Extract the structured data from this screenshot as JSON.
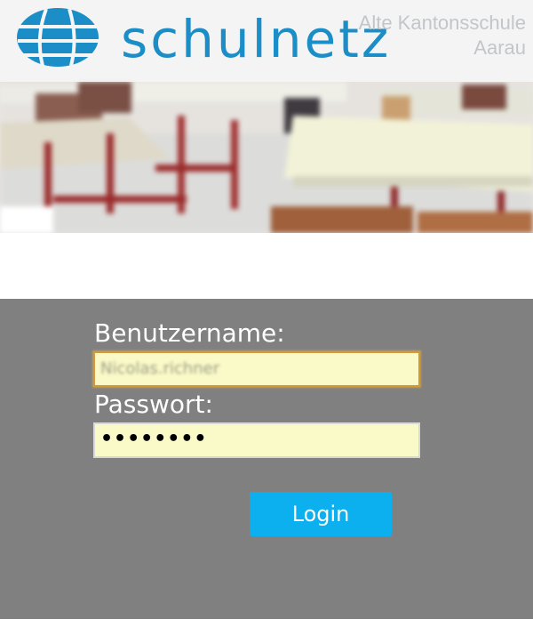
{
  "header": {
    "logo_text": "schulnetz",
    "school_name_line1": "Alte Kantonsschule",
    "school_name_line2": "Aarau"
  },
  "hero": {
    "image": "classroom-photo"
  },
  "login": {
    "username_label": "Benutzername:",
    "username_value": "Nicolas.richner",
    "password_label": "Passwort:",
    "password_value": "••••••••",
    "login_button_label": "Login"
  },
  "colors": {
    "brand_blue": "#1c8ec7",
    "panel_gray": "#808080",
    "input_fill": "#fafac8",
    "button_blue": "#0cb0ee"
  }
}
